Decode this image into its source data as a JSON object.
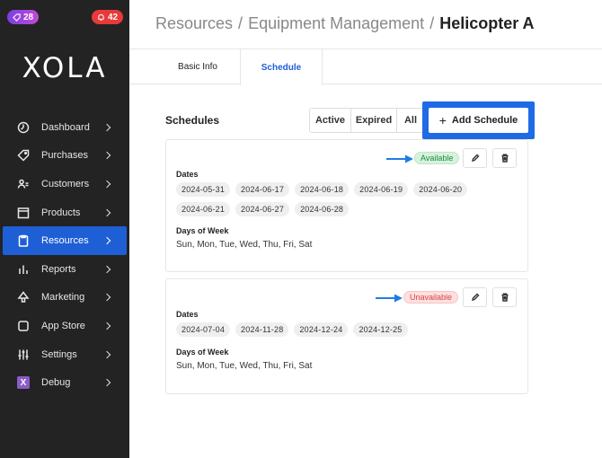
{
  "badges": {
    "left_count": "28",
    "right_count": "42"
  },
  "logo": "XOLA",
  "nav": [
    {
      "label": "Dashboard",
      "icon": "dashboard-icon"
    },
    {
      "label": "Purchases",
      "icon": "tag-icon"
    },
    {
      "label": "Customers",
      "icon": "users-icon"
    },
    {
      "label": "Products",
      "icon": "box-icon"
    },
    {
      "label": "Resources",
      "icon": "clipboard-icon",
      "active": true
    },
    {
      "label": "Reports",
      "icon": "bar-chart-icon"
    },
    {
      "label": "Marketing",
      "icon": "megaphone-icon"
    },
    {
      "label": "App Store",
      "icon": "square-icon"
    },
    {
      "label": "Settings",
      "icon": "sliders-icon"
    },
    {
      "label": "Debug",
      "icon": "debug-icon"
    }
  ],
  "breadcrumb": {
    "part1": "Resources",
    "part2": "Equipment Management",
    "current": "Helicopter A",
    "separator": "/"
  },
  "tabs": {
    "basic": "Basic Info",
    "schedule": "Schedule"
  },
  "schedules": {
    "title": "Schedules",
    "filters": {
      "active": "Active",
      "expired": "Expired",
      "all": "All"
    },
    "add_label": "Add Schedule",
    "dates_label": "Dates",
    "days_label": "Days of Week",
    "cards": [
      {
        "status": "Available",
        "dates": [
          "2024-05-31",
          "2024-06-17",
          "2024-06-18",
          "2024-06-19",
          "2024-06-20",
          "2024-06-21",
          "2024-06-27",
          "2024-06-28"
        ],
        "days": "Sun, Mon, Tue, Wed, Thu, Fri, Sat"
      },
      {
        "status": "Unavailable",
        "dates": [
          "2024-07-04",
          "2024-11-28",
          "2024-12-24",
          "2024-12-25"
        ],
        "days": "Sun, Mon, Tue, Wed, Thu, Fri, Sat"
      }
    ]
  },
  "colors": {
    "sidebar_bg": "#232323",
    "accent": "#1f5fd6",
    "available": "#1f8a3a",
    "unavailable": "#d64545"
  }
}
